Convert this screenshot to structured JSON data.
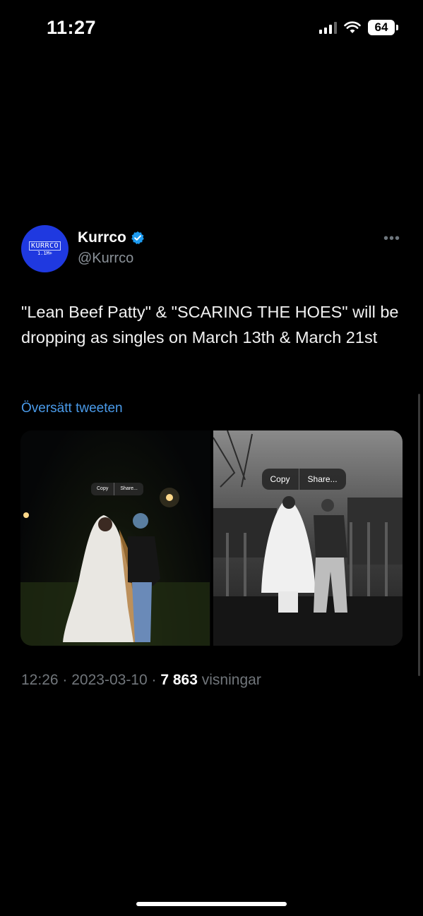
{
  "status_bar": {
    "time": "11:27",
    "battery": "64",
    "signal_icon": "cellular-signal-icon",
    "wifi_icon": "wifi-icon"
  },
  "tweet": {
    "display_name": "Kurrco",
    "handle": "@Kurrco",
    "verified": true,
    "avatar_text": "KURRCO",
    "avatar_subtext": "1.1M+",
    "more_label": "•••",
    "text": "\"Lean Beef Patty\" & \"SCARING THE HOES\" will be dropping as singles on March 13th & March 21st",
    "translate_label": "Översätt tweeten",
    "media": [
      {
        "menu": [
          "Copy",
          "Share..."
        ]
      },
      {
        "menu": [
          "Copy",
          "Share..."
        ]
      }
    ],
    "time": "12:26",
    "date": "2023-03-10",
    "views_count": "7 863",
    "views_label": "visningar",
    "separator": "·"
  },
  "colors": {
    "background": "#000000",
    "link": "#4a9bea",
    "secondary_text": "#71767b",
    "verified_badge": "#1d9bf0"
  }
}
